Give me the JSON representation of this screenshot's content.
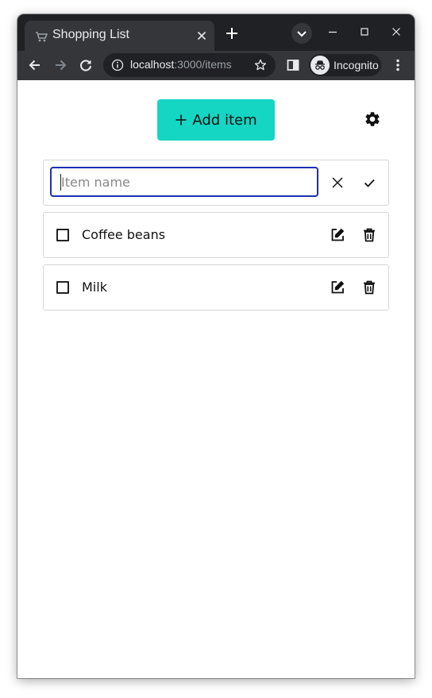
{
  "browser": {
    "tab_title": "Shopping List",
    "url_host": "localhost",
    "url_path": ":3000/items",
    "incognito_label": "Incognito"
  },
  "app": {
    "add_button_label": "Add item",
    "new_item": {
      "placeholder": "Item name",
      "value": ""
    },
    "items": [
      {
        "label": "Coffee beans",
        "checked": false
      },
      {
        "label": "Milk",
        "checked": false
      }
    ]
  },
  "colors": {
    "accent": "#14d6c3",
    "input_focus": "#1f2fb0",
    "browser_frame": "#202124",
    "browser_toolbar": "#35363a"
  },
  "icons": {
    "tab_favicon": "cart-icon",
    "settings": "gear-icon",
    "cancel": "close-icon",
    "confirm": "check-icon",
    "edit": "edit-icon",
    "delete": "trash-icon"
  }
}
